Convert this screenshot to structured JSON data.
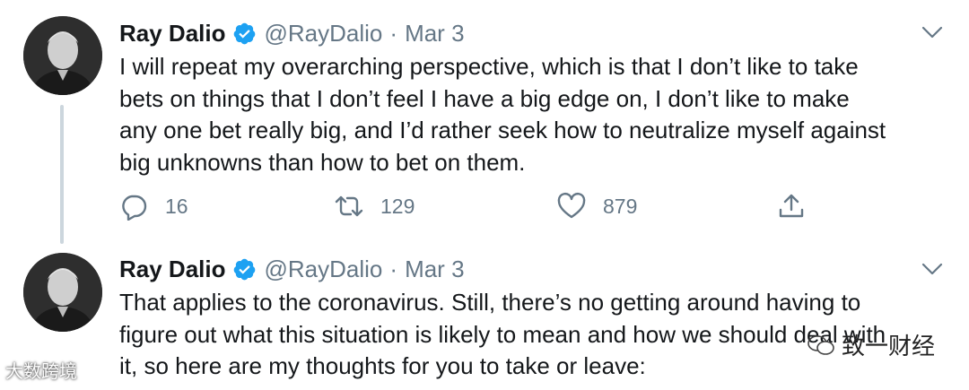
{
  "tweets": [
    {
      "name": "Ray Dalio",
      "handle": "@RayDalio",
      "separator": "·",
      "date": "Mar 3",
      "text": "I will repeat my overarching perspective, which is that I don’t like to take\nbets on things that I don’t feel I have a big edge on, I don’t like to make\nany one bet really big, and I’d rather seek how to neutralize myself against\nbig unknowns than how to bet on them.",
      "replies": "16",
      "retweets": "129",
      "likes": "879"
    },
    {
      "name": "Ray Dalio",
      "handle": "@RayDalio",
      "separator": "·",
      "date": "Mar 3",
      "text": "That applies to the coronavirus. Still, there’s no getting around having to\nfigure out what this situation is likely to mean and how we should deal with\nit, so here are my thoughts for you to take or leave:"
    }
  ],
  "watermarks": {
    "left": "大数跨境",
    "right": "致一财经"
  },
  "colors": {
    "text": "#14171a",
    "secondary": "#657786",
    "verified": "#1da1f2",
    "thread_line": "#ccd6dd"
  },
  "icons": [
    "verified-badge-icon",
    "chevron-down-icon",
    "reply-icon",
    "retweet-icon",
    "like-icon",
    "share-icon"
  ]
}
